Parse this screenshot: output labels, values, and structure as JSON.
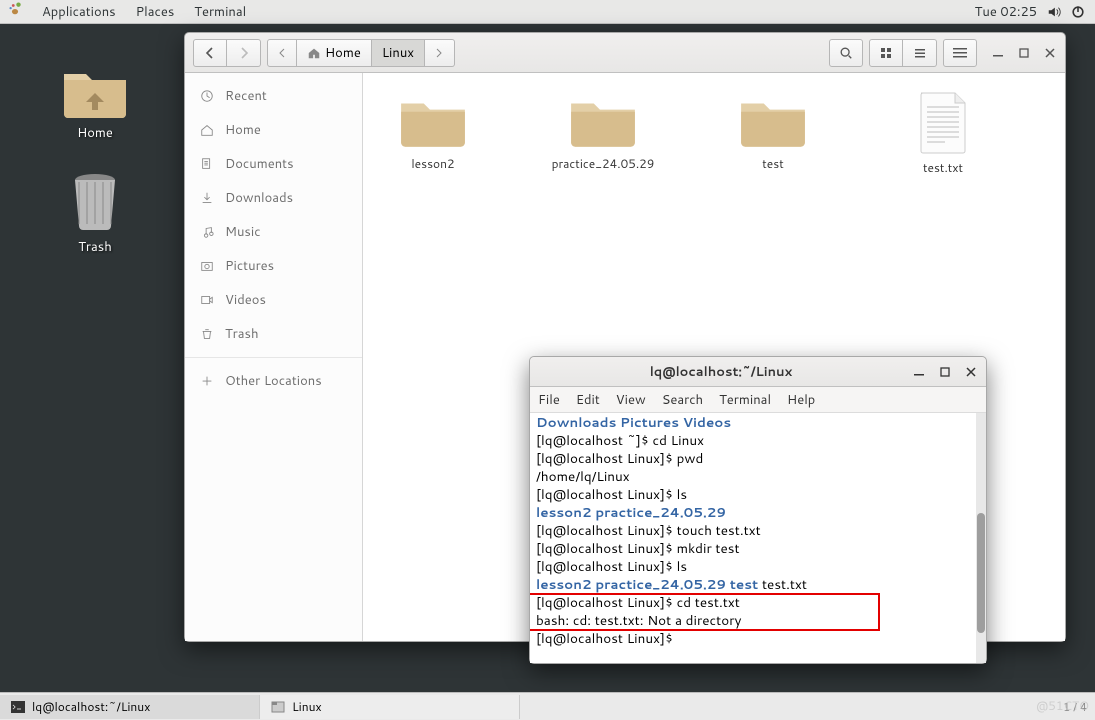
{
  "topbar": {
    "apps": "Applications",
    "places": "Places",
    "terminal": "Terminal",
    "clock": "Tue 02:25"
  },
  "desktop": {
    "home": "Home",
    "trash": "Trash"
  },
  "files": {
    "breadcrumb_home": "Home",
    "breadcrumb_linux": "Linux",
    "sidebar": {
      "recent": "Recent",
      "home": "Home",
      "documents": "Documents",
      "downloads": "Downloads",
      "music": "Music",
      "pictures": "Pictures",
      "videos": "Videos",
      "trash": "Trash",
      "other": "Other Locations"
    },
    "items": [
      "lesson2",
      "practice_24.05.29",
      "test",
      "test.txt"
    ]
  },
  "terminal": {
    "title": "lq@localhost:~/Linux",
    "menu": {
      "file": "File",
      "edit": "Edit",
      "view": "View",
      "search": "Search",
      "terminal": "Terminal",
      "help": "Help"
    },
    "lines": {
      "l0b1": "Downloads",
      "l0b2": "Pictures",
      "l0b3": "Videos",
      "l1p": "[lq@localhost ~]$ ",
      "l1c": "cd Linux",
      "l2p": "[lq@localhost Linux]$ ",
      "l2c": "pwd",
      "l3": "/home/lq/Linux",
      "l4p": "[lq@localhost Linux]$ ",
      "l4c": "ls",
      "l5b1": "lesson2",
      "l5b2": "practice_24.05.29",
      "l6p": "[lq@localhost Linux]$ ",
      "l6c": "touch test.txt",
      "l7p": "[lq@localhost Linux]$ ",
      "l7c": "mkdir test",
      "l8p": "[lq@localhost Linux]$ ",
      "l8c": "ls",
      "l9b1": "lesson2",
      "l9b2": "practice_24.05.29",
      "l9b3": "test",
      "l9t": "  test.txt",
      "l10p": "[lq@localhost Linux]$ ",
      "l10c": "cd test.txt",
      "l11": "bash: cd: test.txt: Not a directory",
      "l12p": "[lq@localhost Linux]$ "
    }
  },
  "taskbar": {
    "task1": "lq@localhost:~/Linux",
    "task2": "Linux",
    "pager": "1 / 4"
  },
  "watermark": "@51CTO"
}
